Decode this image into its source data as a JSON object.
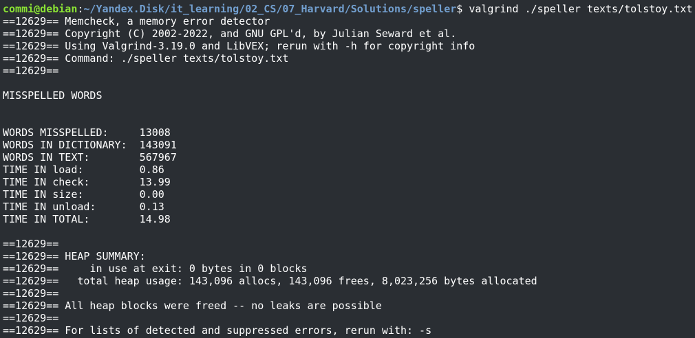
{
  "prompt": {
    "user_host": "commi@debian",
    "separator": ":",
    "path": "~/Yandex.Disk/it_learning/02_CS/07_Harvard/Solutions/speller",
    "symbol": "$ ",
    "command": "valgrind ./speller texts/tolstoy.txt"
  },
  "colors": {
    "background": "#2a2e33",
    "text": "#ffffff",
    "prompt_user": "#8ae234",
    "prompt_path": "#729fcf"
  },
  "lines": [
    "==12629== Memcheck, a memory error detector",
    "==12629== Copyright (C) 2002-2022, and GNU GPL'd, by Julian Seward et al.",
    "==12629== Using Valgrind-3.19.0 and LibVEX; rerun with -h for copyright info",
    "==12629== Command: ./speller texts/tolstoy.txt",
    "==12629==",
    "",
    "MISSPELLED WORDS",
    "",
    "",
    "WORDS MISSPELLED:     13008",
    "WORDS IN DICTIONARY:  143091",
    "WORDS IN TEXT:        567967",
    "TIME IN load:         0.86",
    "TIME IN check:        13.99",
    "TIME IN size:         0.00",
    "TIME IN unload:       0.13",
    "TIME IN TOTAL:        14.98",
    "",
    "==12629==",
    "==12629== HEAP SUMMARY:",
    "==12629==     in use at exit: 0 bytes in 0 blocks",
    "==12629==   total heap usage: 143,096 allocs, 143,096 frees, 8,023,256 bytes allocated",
    "==12629==",
    "==12629== All heap blocks were freed -- no leaks are possible",
    "==12629==",
    "==12629== For lists of detected and suppressed errors, rerun with: -s"
  ]
}
